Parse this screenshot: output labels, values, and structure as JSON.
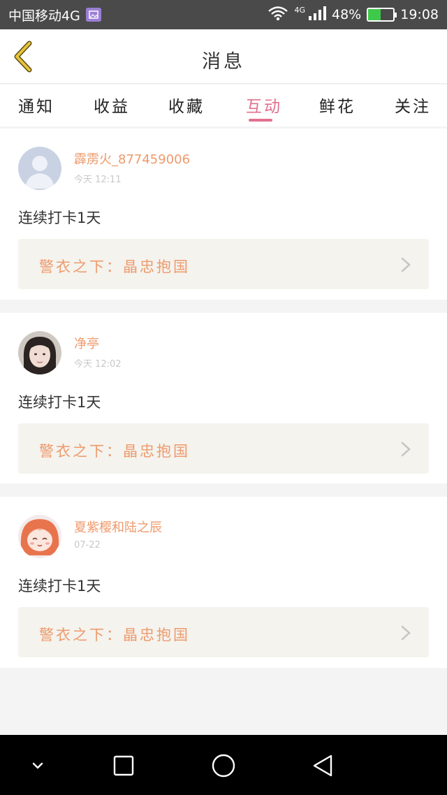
{
  "status_bar": {
    "carrier": "中国移动4G",
    "network_label": "4G",
    "battery_percent": "48%",
    "battery_level": 0.48,
    "time": "19:08"
  },
  "header": {
    "title": "消息"
  },
  "tabs": [
    {
      "label": "通知",
      "active": false
    },
    {
      "label": "收益",
      "active": false
    },
    {
      "label": "收藏",
      "active": false
    },
    {
      "label": "互动",
      "active": true
    },
    {
      "label": "鲜花",
      "active": false
    },
    {
      "label": "关注",
      "active": false
    }
  ],
  "messages": [
    {
      "username": "霹雳火_877459006",
      "time": "今天 12:11",
      "content": "连续打卡1天",
      "link_title": "警衣之下：晶忠抱国",
      "avatar": "default-avatar"
    },
    {
      "username": "净亭",
      "time": "今天 12:02",
      "content": "连续打卡1天",
      "link_title": "警衣之下：晶忠抱国",
      "avatar": "photo-avatar"
    },
    {
      "username": "夏紫樱和陆之辰",
      "time": "07-22",
      "content": "连续打卡1天",
      "link_title": "警衣之下：晶忠抱国",
      "avatar": "anime-avatar"
    }
  ],
  "colors": {
    "accent": "#e2708f",
    "username": "#ee9a6c",
    "back_arrow": "#e6c43c"
  },
  "nav": {
    "icons": [
      "chevron-down-icon",
      "recents-square-icon",
      "home-circle-icon",
      "back-triangle-icon"
    ]
  }
}
